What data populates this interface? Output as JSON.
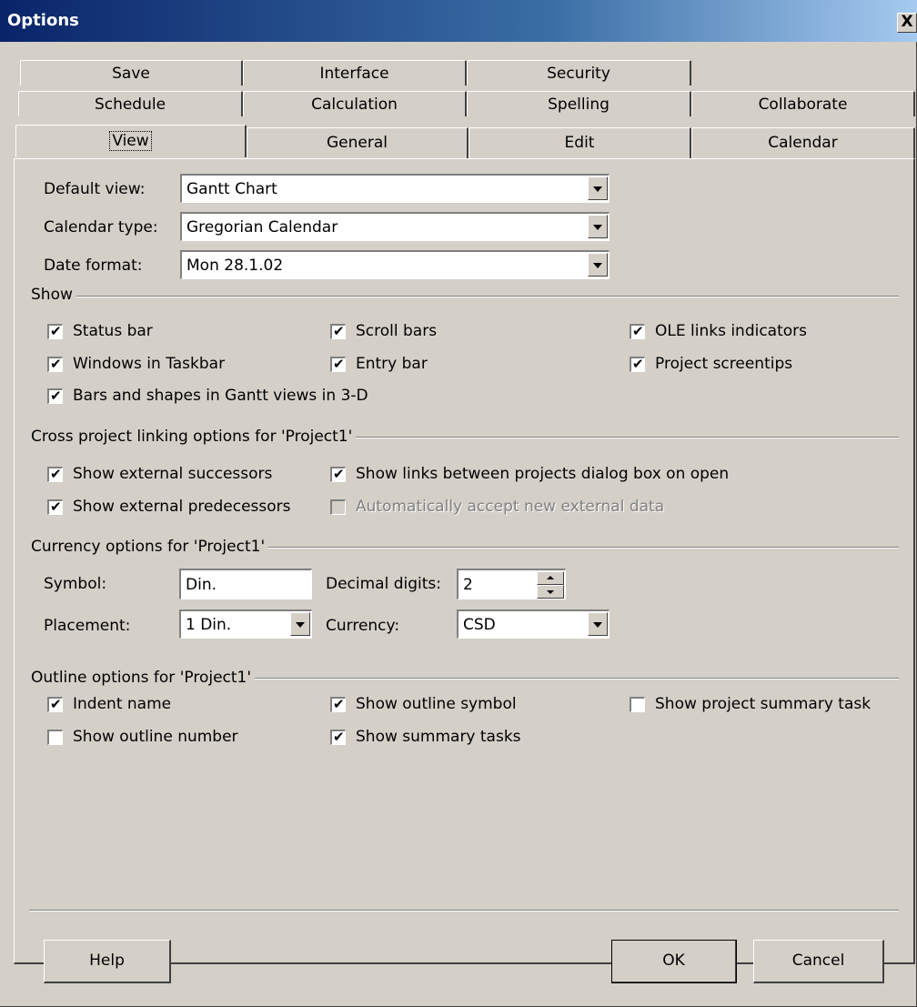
{
  "window": {
    "title": "Options",
    "close_glyph": "X"
  },
  "tabs": {
    "row1": [
      "Save",
      "Interface",
      "Security"
    ],
    "row2": [
      "Schedule",
      "Calculation",
      "Spelling",
      "Collaborate"
    ],
    "row3": [
      "View",
      "General",
      "Edit",
      "Calendar"
    ],
    "active": "View"
  },
  "view": {
    "default_view": {
      "label": "Default view:",
      "value": "Gantt Chart"
    },
    "calendar_type": {
      "label": "Calendar type:",
      "value": "Gregorian Calendar"
    },
    "date_format": {
      "label": "Date format:",
      "value": "Mon 28.1.02"
    }
  },
  "show": {
    "title": "Show",
    "items": [
      {
        "label": "Status bar",
        "checked": true
      },
      {
        "label": "Scroll bars",
        "checked": true
      },
      {
        "label": "OLE links indicators",
        "checked": true
      },
      {
        "label": "Windows in Taskbar",
        "checked": true
      },
      {
        "label": "Entry bar",
        "checked": true
      },
      {
        "label": "Project screentips",
        "checked": true
      },
      {
        "label": "Bars and shapes in Gantt views in 3-D",
        "checked": true
      }
    ]
  },
  "cross": {
    "title": "Cross project linking options for 'Project1'",
    "items": [
      {
        "label": "Show external successors",
        "checked": true
      },
      {
        "label": "Show links between projects dialog box on open",
        "checked": true
      },
      {
        "label": "Show external predecessors",
        "checked": true
      },
      {
        "label": "Automatically accept new external data",
        "checked": false,
        "disabled": true
      }
    ]
  },
  "currency": {
    "title": "Currency options for 'Project1'",
    "symbol": {
      "label": "Symbol:",
      "value": "Din."
    },
    "decimal": {
      "label": "Decimal digits:",
      "value": "2"
    },
    "placement": {
      "label": "Placement:",
      "value": "1 Din."
    },
    "currency": {
      "label": "Currency:",
      "value": "CSD"
    }
  },
  "outline": {
    "title": "Outline options for 'Project1'",
    "items": [
      {
        "label": "Indent name",
        "checked": true
      },
      {
        "label": "Show outline symbol",
        "checked": true
      },
      {
        "label": "Show project summary task",
        "checked": false
      },
      {
        "label": "Show outline number",
        "checked": false
      },
      {
        "label": "Show summary tasks",
        "checked": true
      }
    ]
  },
  "buttons": {
    "help": "Help",
    "ok": "OK",
    "cancel": "Cancel"
  }
}
